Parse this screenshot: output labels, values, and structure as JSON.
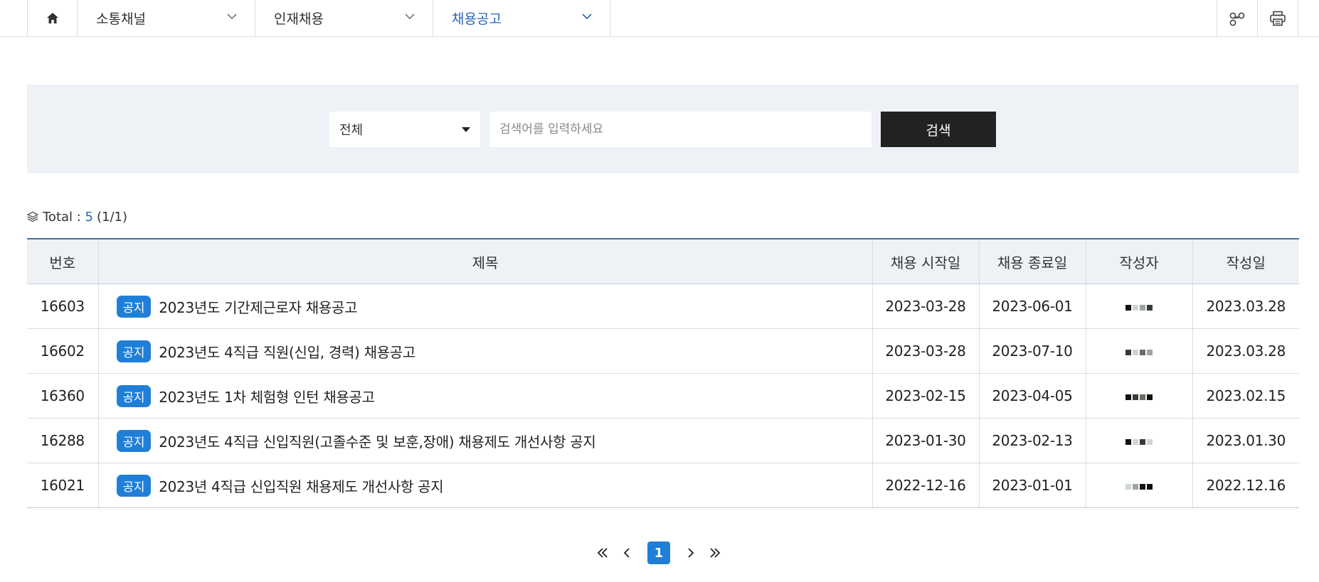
{
  "nav": {
    "menus": [
      {
        "label": "소통채널"
      },
      {
        "label": "인재채용"
      },
      {
        "label": "채용공고"
      }
    ],
    "active_color": "#2a63b7"
  },
  "search": {
    "scope_selected": "전체",
    "placeholder": "검색어를 입력하세요",
    "button_label": "검색"
  },
  "summary": {
    "prefix": "Total : ",
    "count": "5",
    "page_info": "(1/1)"
  },
  "table": {
    "headers": {
      "no": "번호",
      "title": "제목",
      "start": "채용 시작일",
      "end": "채용 종료일",
      "author": "작성자",
      "created": "작성일"
    },
    "badge_label": "공지",
    "rows": [
      {
        "no": "16603",
        "title": "2023년도 기간제근로자 채용공고",
        "start": "2023-03-28",
        "end": "2023-06-01",
        "created": "2023.03.28"
      },
      {
        "no": "16602",
        "title": "2023년도 4직급 직원(신입, 경력) 채용공고",
        "start": "2023-03-28",
        "end": "2023-07-10",
        "created": "2023.03.28"
      },
      {
        "no": "16360",
        "title": "2023년도 1차 체험형 인턴 채용공고",
        "start": "2023-02-15",
        "end": "2023-04-05",
        "created": "2023.02.15"
      },
      {
        "no": "16288",
        "title": "2023년도 4직급 신입직원(고졸수준 및 보훈,장애) 채용제도 개선사항 공지",
        "start": "2023-01-30",
        "end": "2023-02-13",
        "created": "2023.01.30"
      },
      {
        "no": "16021",
        "title": "2023년 4직급 신입직원 채용제도 개선사항 공지",
        "start": "2022-12-16",
        "end": "2023-01-01",
        "created": "2022.12.16"
      }
    ]
  },
  "pagination": {
    "current": "1"
  },
  "colors": {
    "accent": "#1f7fd8",
    "panel_bg": "#eef2f6",
    "search_button_bg": "#222222"
  },
  "icons": [
    "home-icon",
    "chevron-down-icon",
    "share-icon",
    "print-icon",
    "layers-icon",
    "double-chevron-left-icon",
    "chevron-left-icon",
    "chevron-right-icon",
    "double-chevron-right-icon"
  ]
}
